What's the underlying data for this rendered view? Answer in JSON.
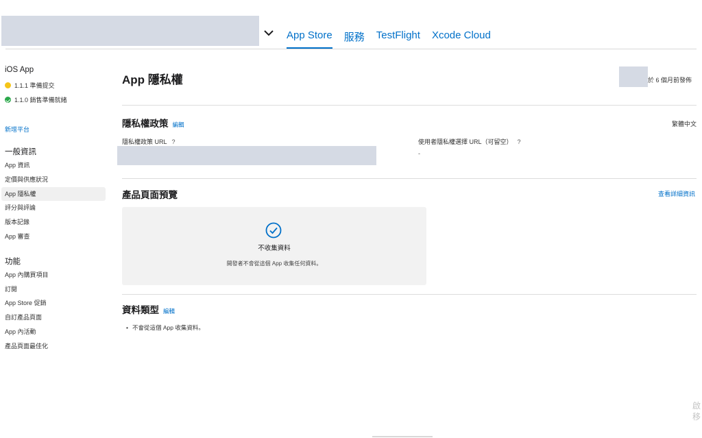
{
  "header": {
    "tabs": [
      {
        "label": "App Store",
        "active": true
      },
      {
        "label": "服務",
        "active": false
      },
      {
        "label": "TestFlight",
        "active": false
      },
      {
        "label": "Xcode Cloud",
        "active": false
      }
    ]
  },
  "sidebar": {
    "platform_title": "iOS App",
    "versions": [
      {
        "label": "1.1.1 準備提交",
        "status_color": "#f5c518"
      },
      {
        "label": "1.1.0 銷售準備就緒",
        "status_color": "#2aa84a"
      }
    ],
    "add_platform": "新增平台",
    "sections": [
      {
        "title": "一般資訊",
        "items": [
          "App 資訊",
          "定價與供應狀況",
          "App 隱私權",
          "評分與評論",
          "版本記錄",
          "App 審查"
        ]
      },
      {
        "title": "功能",
        "items": [
          "App 內購買項目",
          "訂閱",
          "App Store 促銷",
          "自訂產品頁面",
          "App 內活動",
          "產品頁面最佳化"
        ]
      }
    ],
    "active_item": "App 隱私權"
  },
  "main": {
    "title": "App 隱私權",
    "published": "於 6 個月前發佈",
    "privacy_policy": {
      "title": "隱私權政策",
      "edit": "編輯",
      "language": "繁體中文",
      "policy_url_label": "隱私權政策 URL",
      "choices_url_label": "使用者隱私權選擇 URL（可留空）",
      "choices_url_value": "-",
      "help": "?"
    },
    "preview": {
      "title": "產品頁面預覽",
      "details_link": "查看詳細資訊",
      "card_title": "不收集資料",
      "card_subtitle": "開發者不會從這個 App 收集任何資料。"
    },
    "data_types": {
      "title": "資料類型",
      "edit": "編輯",
      "bullet": "不會從這個 App 收集資料。"
    }
  },
  "corner_text": [
    "啟",
    "移"
  ],
  "colors": {
    "accent": "#0070c9",
    "redaction": "#d5dae4",
    "card_bg": "#f2f2f2"
  }
}
